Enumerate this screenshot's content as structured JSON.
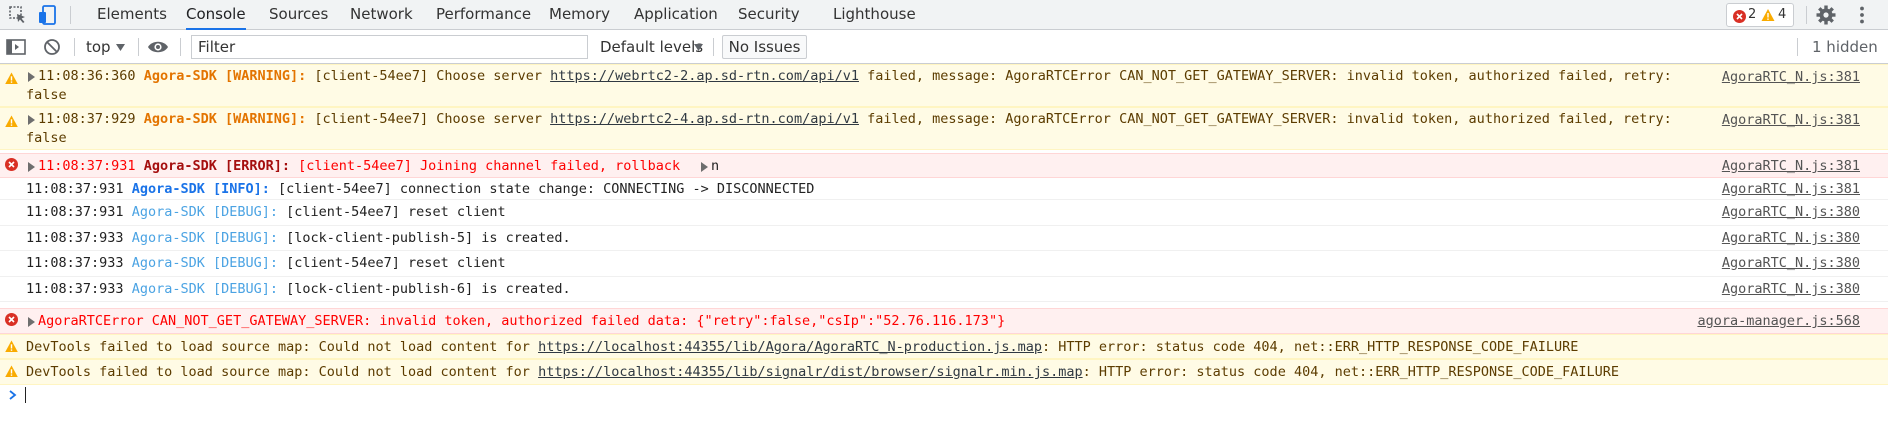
{
  "tabs": [
    "Elements",
    "Console",
    "Sources",
    "Network",
    "Performance",
    "Memory",
    "Application",
    "Security",
    "Lighthouse"
  ],
  "active_tab": "Console",
  "counts": {
    "errors": "2",
    "warnings": "4"
  },
  "toolbar": {
    "context": "top",
    "filter_placeholder": "Filter",
    "levels": "Default levels",
    "issues": "No Issues",
    "hidden": "1 hidden"
  },
  "messages": [
    {
      "level": "warning",
      "time": "11:08:36:360",
      "tag": "Agora-SDK [WARNING]:",
      "pre": "[client-54ee7] Choose server",
      "url": "https://webrtc2-2.ap.sd-rtn.com/api/v1",
      "post": "failed, message: AgoraRTCError CAN_NOT_GET_GATEWAY_SERVER: invalid token, authorized failed, retry:",
      "wrap": "false",
      "source": "AgoraRTC_N.js:381"
    },
    {
      "level": "warning",
      "time": "11:08:37:929",
      "tag": "Agora-SDK [WARNING]:",
      "pre": "[client-54ee7] Choose server",
      "url": "https://webrtc2-4.ap.sd-rtn.com/api/v1",
      "post": "failed, message: AgoraRTCError CAN_NOT_GET_GATEWAY_SERVER: invalid token, authorized failed, retry:",
      "wrap": "false",
      "source": "AgoraRTC_N.js:381"
    },
    {
      "level": "error",
      "time": "11:08:37:931",
      "tag": "Agora-SDK [ERROR]:",
      "text": "[client-54ee7] Joining channel failed, rollback",
      "object": "n",
      "source": "AgoraRTC_N.js:381"
    },
    {
      "level": "info",
      "time": "11:08:37:931",
      "tag": "Agora-SDK [INFO]:",
      "text": "[client-54ee7] connection state change: CONNECTING -> DISCONNECTED",
      "source": "AgoraRTC_N.js:381"
    },
    {
      "level": "debug",
      "time": "11:08:37:931",
      "tag": "Agora-SDK [DEBUG]:",
      "text": "[client-54ee7] reset client",
      "source": "AgoraRTC_N.js:380"
    },
    {
      "level": "debug",
      "time": "11:08:37:933",
      "tag": "Agora-SDK [DEBUG]:",
      "text": "[lock-client-publish-5] is created.",
      "source": "AgoraRTC_N.js:380"
    },
    {
      "level": "debug",
      "time": "11:08:37:933",
      "tag": "Agora-SDK [DEBUG]:",
      "text": "[client-54ee7] reset client",
      "source": "AgoraRTC_N.js:380"
    },
    {
      "level": "debug",
      "time": "11:08:37:933",
      "tag": "Agora-SDK [DEBUG]:",
      "text": "[lock-client-publish-6] is created.",
      "source": "AgoraRTC_N.js:380"
    },
    {
      "level": "error",
      "text": "AgoraRTCError CAN_NOT_GET_GATEWAY_SERVER: invalid token, authorized failed data: {\"retry\":false,\"csIp\":\"52.76.116.173\"}",
      "source": "agora-manager.js:568"
    },
    {
      "level": "warning",
      "pre": "DevTools failed to load source map: Could not load content for",
      "url": "https://localhost:44355/lib/Agora/AgoraRTC_N-production.js.map",
      "post": ": HTTP error: status code 404, net::ERR_HTTP_RESPONSE_CODE_FAILURE"
    },
    {
      "level": "warning",
      "pre": "DevTools failed to load source map: Could not load content for",
      "url": "https://localhost:44355/lib/signalr/dist/browser/signalr.min.js.map",
      "post": ": HTTP error: status code 404, net::ERR_HTTP_RESPONSE_CODE_FAILURE"
    }
  ],
  "colors": {
    "warning_bg": "#fffbe5",
    "error_bg": "#fff0f0",
    "error_text": "#ff0000",
    "warn_tag": "#e37400",
    "info_tag": "#1a73e8",
    "debug_tag": "#4ba3e3",
    "accent": "#1a73e8"
  },
  "icons": [
    "inspect-element-icon",
    "device-toolbar-icon",
    "sidebar-toggle-icon",
    "clear-console-icon",
    "eye-icon",
    "settings-gear-icon",
    "more-menu-icon",
    "warning-icon",
    "error-icon",
    "expand-triangle-icon",
    "console-prompt-icon"
  ]
}
